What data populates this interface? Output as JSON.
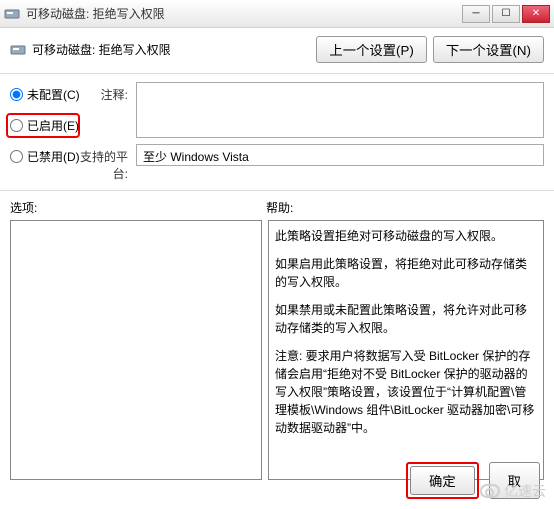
{
  "window": {
    "title": "可移动磁盘: 拒绝写入权限"
  },
  "header": {
    "title": "可移动磁盘: 拒绝写入权限",
    "prev_button": "上一个设置(P)",
    "next_button": "下一个设置(N)"
  },
  "radios": {
    "not_configured": "未配置(C)",
    "enabled": "已启用(E)",
    "disabled": "已禁用(D)",
    "selected": "not_configured"
  },
  "fields": {
    "comment_label": "注释:",
    "comment_value": "",
    "platform_label": "支持的平台:",
    "platform_value": "至少 Windows Vista"
  },
  "sections": {
    "options_label": "选项:",
    "help_label": "帮助:"
  },
  "help": {
    "p1": "此策略设置拒绝对可移动磁盘的写入权限。",
    "p2": "如果启用此策略设置，将拒绝对此可移动存储类的写入权限。",
    "p3": "如果禁用或未配置此策略设置，将允许对此可移动存储类的写入权限。",
    "p4": "注意: 要求用户将数据写入受 BitLocker 保护的存储会启用“拒绝对不受 BitLocker 保护的驱动器的写入权限”策略设置，该设置位于“计算机配置\\管理模板\\Windows 组件\\BitLocker 驱动器加密\\可移动数据驱动器”中。"
  },
  "footer": {
    "ok": "确定",
    "cancel": "取"
  },
  "watermark": {
    "text": "亿速云"
  }
}
